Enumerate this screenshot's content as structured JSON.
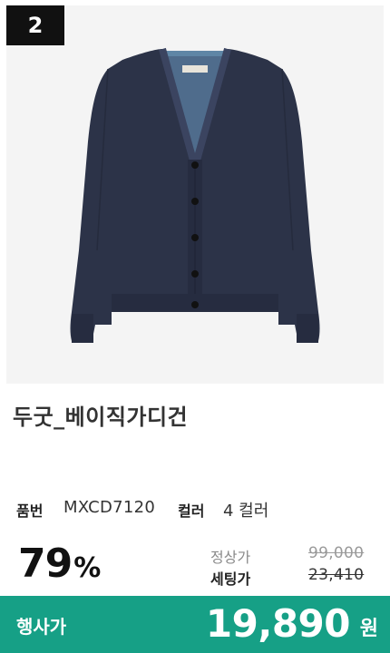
{
  "rank": "2",
  "product": {
    "name": "두굿_베이직가디건",
    "image_icon": "cardigan-photo"
  },
  "specs": {
    "code_label": "품번",
    "code_value": "MXCD7120",
    "color_label": "컬러",
    "color_value": "4 컬러"
  },
  "discount": {
    "value": "79",
    "unit": "%"
  },
  "prices": {
    "regular_label": "정상가",
    "regular_value": "99,000",
    "set_label": "세팅가",
    "set_value": "23,410"
  },
  "event": {
    "label": "행사가",
    "price": "19,890",
    "currency": "원"
  },
  "colors": {
    "accent": "#16a086",
    "badge": "#111111",
    "garment": "#2c3348"
  }
}
